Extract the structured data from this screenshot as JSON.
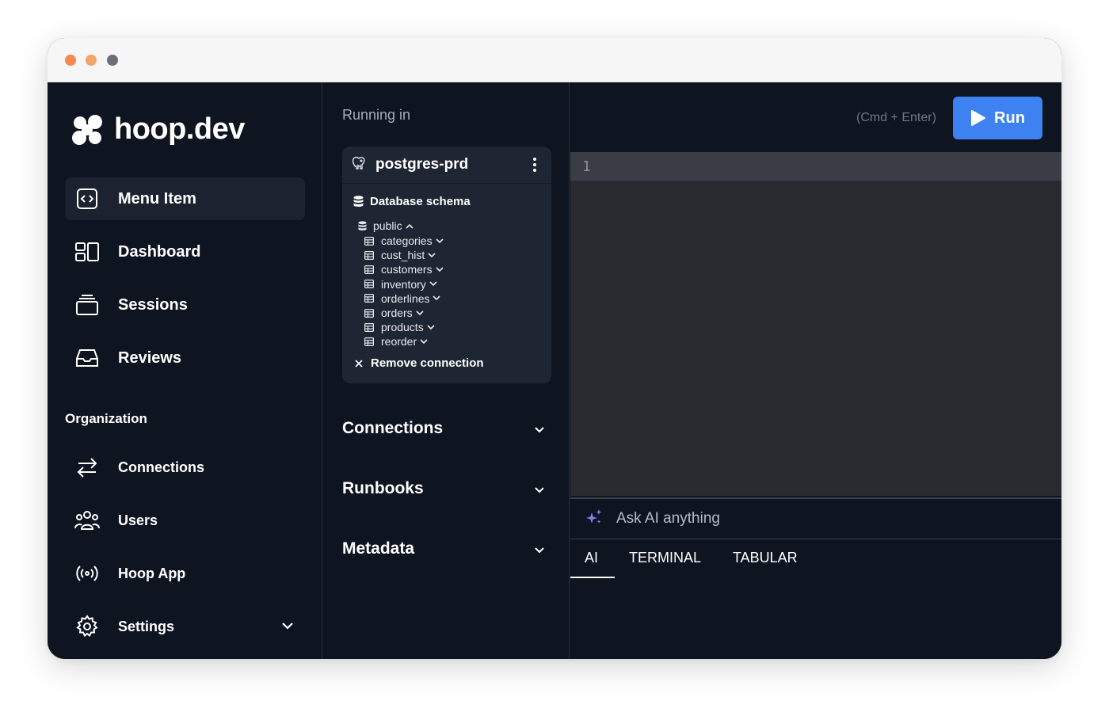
{
  "brand": {
    "name": "hoop.dev"
  },
  "sidebar": {
    "items": [
      {
        "label": "Menu Item",
        "icon": "code-window-icon",
        "active": true
      },
      {
        "label": "Dashboard",
        "icon": "dashboard-icon"
      },
      {
        "label": "Sessions",
        "icon": "sessions-icon"
      },
      {
        "label": "Reviews",
        "icon": "inbox-icon"
      }
    ],
    "section_title": "Organization",
    "org_items": [
      {
        "label": "Connections",
        "icon": "arrows-exchange-icon"
      },
      {
        "label": "Users",
        "icon": "users-icon"
      },
      {
        "label": "Hoop App",
        "icon": "broadcast-icon"
      },
      {
        "label": "Settings",
        "icon": "gear-icon"
      }
    ]
  },
  "panel": {
    "running_in": "Running in",
    "connection": {
      "name": "postgres-prd",
      "schema_title": "Database schema",
      "schema": "public",
      "tables": [
        "categories",
        "cust_hist",
        "customers",
        "inventory",
        "orderlines",
        "orders",
        "products",
        "reorder"
      ],
      "remove_label": "Remove connection"
    },
    "accordions": [
      "Connections",
      "Runbooks",
      "Metadata"
    ]
  },
  "editor": {
    "shortcut": "(Cmd + Enter)",
    "run_label": "Run",
    "line_number": "1",
    "ai_placeholder": "Ask AI anything",
    "tabs": [
      "AI",
      "TERMINAL",
      "TABULAR"
    ],
    "active_tab": "AI"
  },
  "colors": {
    "background": "#0f1421",
    "run_button": "#3d82f0",
    "editor": "#292b31",
    "traffic_lights": [
      "#f48a4c",
      "#f4a463",
      "#6b6f78"
    ]
  }
}
